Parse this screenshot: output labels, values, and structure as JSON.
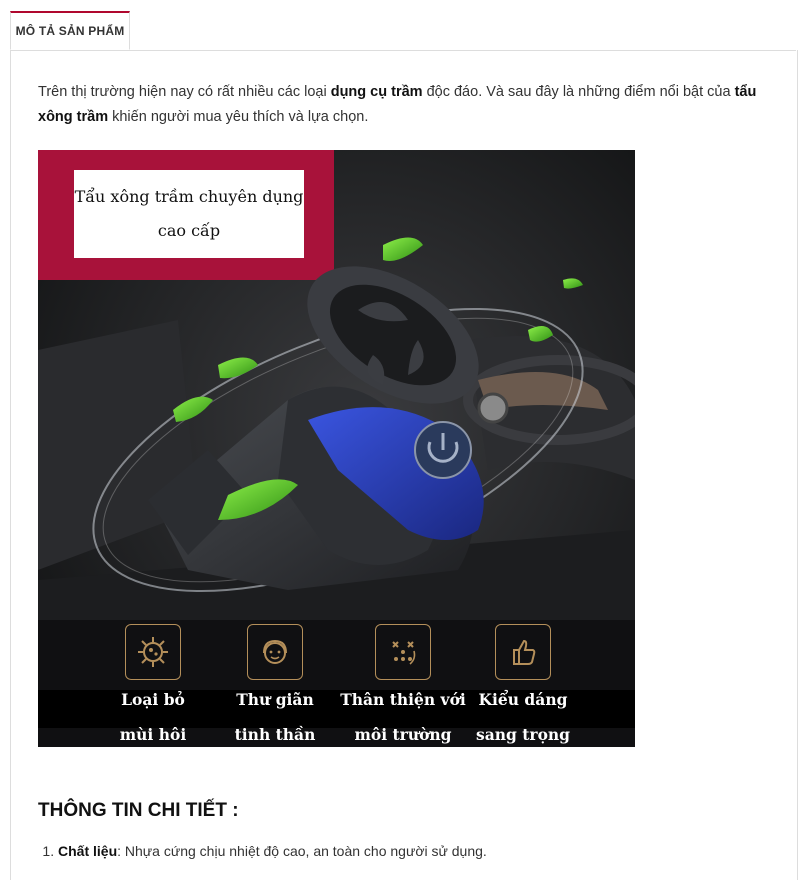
{
  "tab": {
    "label": "MÔ TẢ SẢN PHẨM"
  },
  "intro": {
    "part1": "Trên thị trường hiện nay có rất nhiều các loại ",
    "bold1": "dụng cụ trầm",
    "part2": " độc đáo. Và sau đây là những điểm nổi bật của ",
    "bold2": "tẩu xông trầm",
    "part3": " khiến người mua yêu thích và lựa chọn."
  },
  "image": {
    "banner_line1": "Tẩu xông trầm chuyên dụng",
    "banner_line2": "cao cấp",
    "features": [
      {
        "line1": "Loại bỏ",
        "line2": "mùi hôi",
        "icon": "virus-icon"
      },
      {
        "line1": "Thư giãn",
        "line2": "tinh thần",
        "icon": "headset-face-icon"
      },
      {
        "line1": "Thân thiện với",
        "line2": "môi trường",
        "icon": "eco-cycle-icon"
      },
      {
        "line1": "Kiểu dáng",
        "line2": "sang trọng",
        "icon": "thumbs-up-icon"
      }
    ]
  },
  "details": {
    "title": "THÔNG TIN CHI TIẾT :",
    "items": [
      {
        "label": "Chất liệu",
        "text": ": Nhựa cứng chịu nhiệt độ cao, an toàn cho người sử dụng."
      }
    ]
  },
  "colors": {
    "accent": "#b0082e",
    "banner": "#a8123a",
    "device_blue": "#2a3fb0",
    "leaf_green": "#5bc92b"
  }
}
